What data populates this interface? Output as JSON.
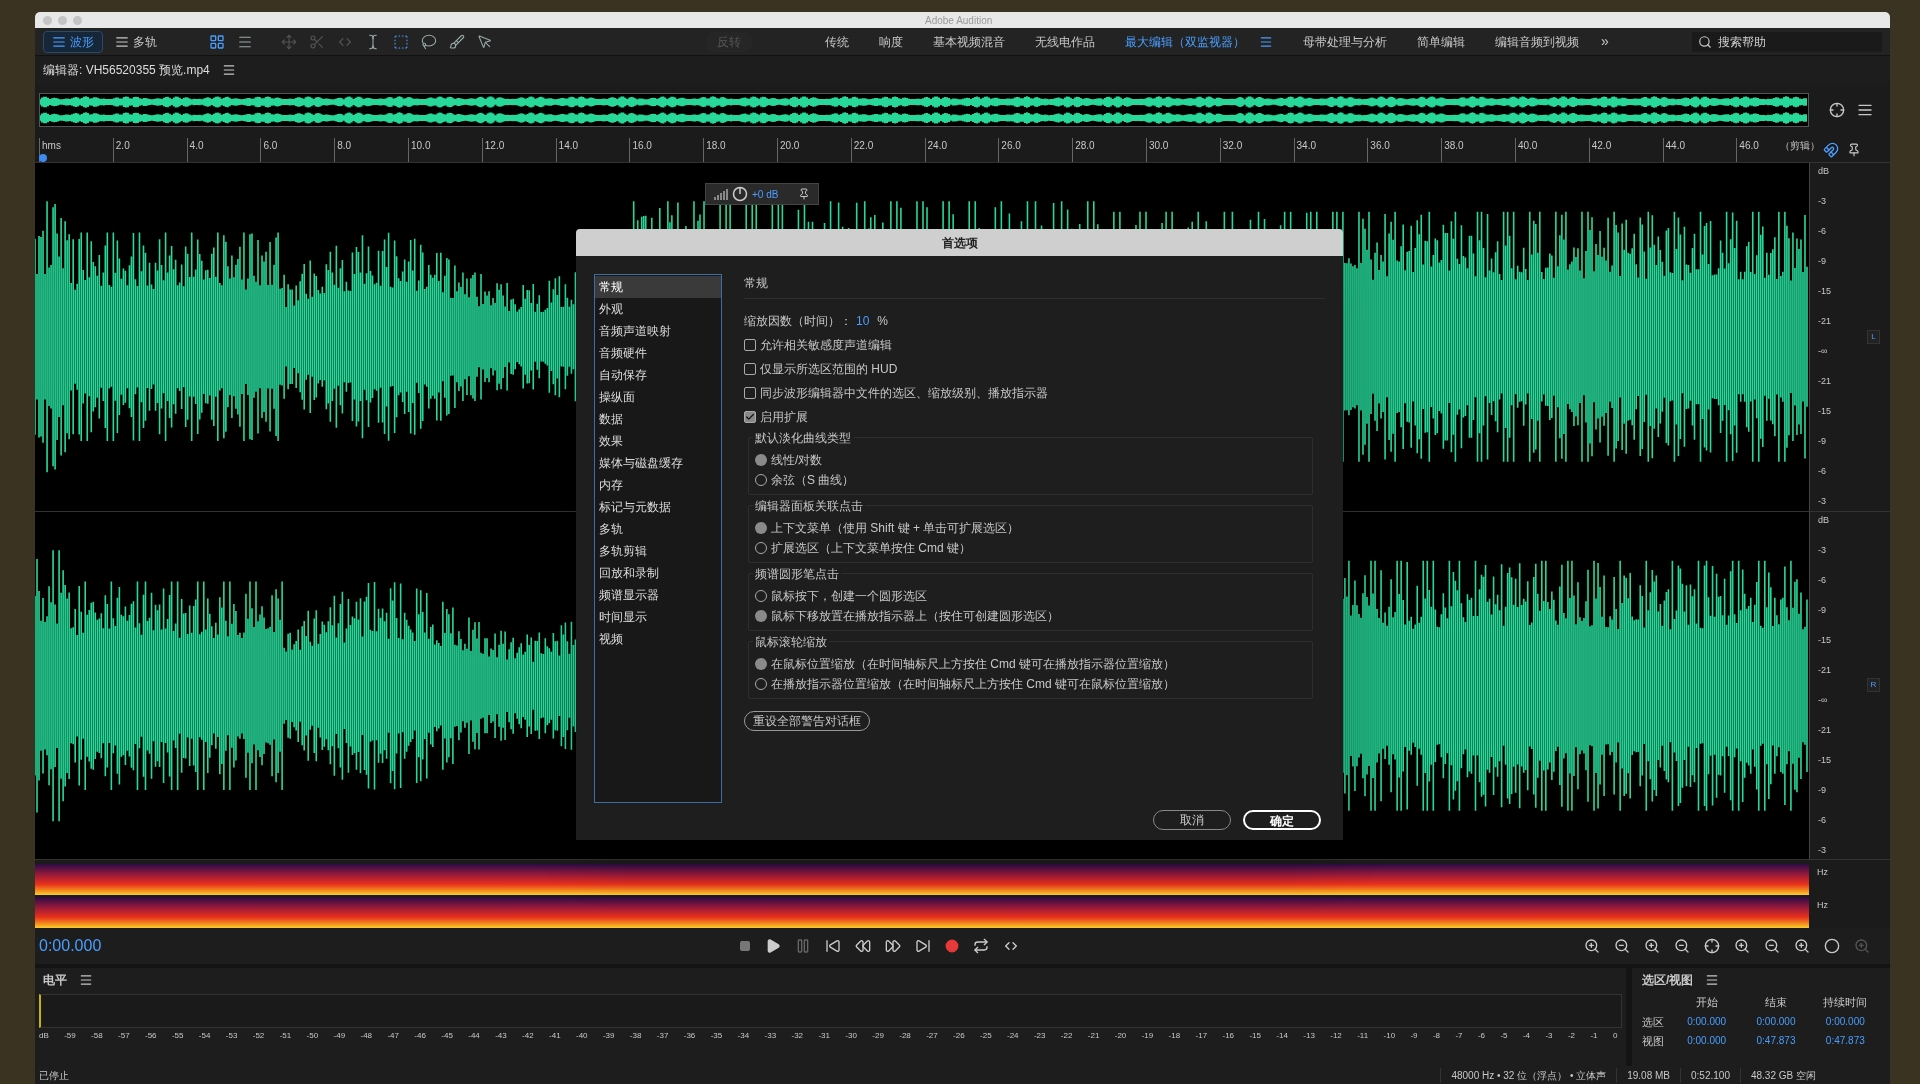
{
  "window": {
    "title": "Adobe Audition"
  },
  "mode_tabs": [
    {
      "label": "波形",
      "selected": true
    },
    {
      "label": "多轨",
      "selected": false
    }
  ],
  "reverse_button": {
    "label": "反转",
    "disabled": true
  },
  "workspaces": [
    {
      "label": "传统",
      "selected": false
    },
    {
      "label": "响度",
      "selected": false
    },
    {
      "label": "基本视频混音",
      "selected": false
    },
    {
      "label": "无线电作品",
      "selected": false
    },
    {
      "label": "最大编辑（双监视器）",
      "selected": true
    },
    {
      "label": "母带处理与分析",
      "selected": false
    },
    {
      "label": "简单编辑",
      "selected": false
    },
    {
      "label": "编辑音频到视频",
      "selected": false
    }
  ],
  "more_workspaces": "»",
  "search": {
    "placeholder": "搜索帮助"
  },
  "editor": {
    "title": "编辑器: VH56520355 预览.mp4"
  },
  "ruler": {
    "labels": [
      "hms",
      "2.0",
      "4.0",
      "6.0",
      "8.0",
      "10.0",
      "12.0",
      "14.0",
      "16.0",
      "18.0",
      "20.0",
      "22.0",
      "24.0",
      "26.0",
      "28.0",
      "30.0",
      "32.0",
      "34.0",
      "36.0",
      "38.0",
      "40.0",
      "42.0",
      "44.0",
      "46.0"
    ],
    "suffix": "（剪辑）"
  },
  "hud": {
    "reading": "+0 dB"
  },
  "db_scales": [
    {
      "channel": "L",
      "labels": [
        "dB",
        "-3",
        "-6",
        "-9",
        "-15",
        "-21",
        "-∞",
        "-21",
        "-15",
        "-9",
        "-6",
        "-3"
      ]
    },
    {
      "channel": "R",
      "labels": [
        "dB",
        "-3",
        "-6",
        "-9",
        "-15",
        "-21",
        "-∞",
        "-21",
        "-15",
        "-9",
        "-6",
        "-3"
      ]
    }
  ],
  "spectrum_labels": [
    "Hz",
    "Hz"
  ],
  "dialog": {
    "title": "首选项",
    "nav": [
      {
        "label": "常规",
        "selected": true
      },
      {
        "label": "外观",
        "selected": false
      },
      {
        "label": "音频声道映射",
        "selected": false
      },
      {
        "label": "音频硬件",
        "selected": false
      },
      {
        "label": "自动保存",
        "selected": false
      },
      {
        "label": "操纵面",
        "selected": false
      },
      {
        "label": "数据",
        "selected": false
      },
      {
        "label": "效果",
        "selected": false
      },
      {
        "label": "媒体与磁盘缓存",
        "selected": false
      },
      {
        "label": "内存",
        "selected": false
      },
      {
        "label": "标记与元数据",
        "selected": false
      },
      {
        "label": "多轨",
        "selected": false
      },
      {
        "label": "多轨剪辑",
        "selected": false
      },
      {
        "label": "回放和录制",
        "selected": false
      },
      {
        "label": "频谱显示器",
        "selected": false
      },
      {
        "label": "时间显示",
        "selected": false
      },
      {
        "label": "视频",
        "selected": false
      }
    ],
    "section_title": "常规",
    "zoom": {
      "label": "缩放因数（时间）：",
      "value": "10",
      "unit": "%"
    },
    "checkboxes": [
      {
        "label": "允许相关敏感度声道编辑",
        "checked": false
      },
      {
        "label": "仅显示所选区范围的 HUD",
        "checked": false
      },
      {
        "label": "同步波形编辑器中文件的选区、缩放级别、播放指示器",
        "checked": false
      },
      {
        "label": "启用扩展",
        "checked": true
      }
    ],
    "groups": [
      {
        "title": "默认淡化曲线类型",
        "options": [
          {
            "label": "线性/对数",
            "selected": true
          },
          {
            "label": "余弦（S 曲线）",
            "selected": false
          }
        ]
      },
      {
        "title": "编辑器面板关联点击",
        "options": [
          {
            "label": "上下文菜单（使用 Shift 键 + 单击可扩展选区）",
            "selected": true
          },
          {
            "label": "扩展选区（上下文菜单按住 Cmd 键）",
            "selected": false
          }
        ]
      },
      {
        "title": "频谱圆形笔点击",
        "options": [
          {
            "label": "鼠标按下，创建一个圆形选区",
            "selected": false
          },
          {
            "label": "鼠标下移放置在播放指示器上（按住可创建圆形选区）",
            "selected": true
          }
        ]
      },
      {
        "title": "鼠标滚轮缩放",
        "options": [
          {
            "label": "在鼠标位置缩放（在时间轴标尺上方按住 Cmd 键可在播放指示器位置缩放）",
            "selected": true
          },
          {
            "label": "在播放指示器位置缩放（在时间轴标尺上方按住 Cmd 键可在鼠标位置缩放）",
            "selected": false
          }
        ]
      }
    ],
    "reset_button": "重设全部警告对话框",
    "buttons": [
      {
        "label": "取消",
        "kind": "cancel"
      },
      {
        "label": "确定",
        "kind": "default"
      }
    ]
  },
  "transport": {
    "time": "0:00.000"
  },
  "levels": {
    "title": "电平",
    "scale": [
      "dB",
      "-59",
      "-58",
      "-57",
      "-56",
      "-55",
      "-54",
      "-53",
      "-52",
      "-51",
      "-50",
      "-49",
      "-48",
      "-47",
      "-46",
      "-45",
      "-44",
      "-43",
      "-42",
      "-41",
      "-40",
      "-39",
      "-38",
      "-37",
      "-36",
      "-35",
      "-34",
      "-33",
      "-32",
      "-31",
      "-30",
      "-29",
      "-28",
      "-27",
      "-26",
      "-25",
      "-24",
      "-23",
      "-22",
      "-21",
      "-20",
      "-19",
      "-18",
      "-17",
      "-16",
      "-15",
      "-14",
      "-13",
      "-12",
      "-11",
      "-10",
      "-9",
      "-8",
      "-7",
      "-6",
      "-5",
      "-4",
      "-3",
      "-2",
      "-1",
      "0"
    ]
  },
  "selection_view": {
    "title": "选区/视图",
    "columns": [
      "开始",
      "结束",
      "持续时间"
    ],
    "rows": [
      {
        "label": "选区",
        "values": [
          "0:00.000",
          "0:00.000",
          "0:00.000"
        ]
      },
      {
        "label": "视图",
        "values": [
          "0:00.000",
          "0:47.873",
          "0:47.873"
        ]
      }
    ]
  },
  "status_bar": {
    "state": "已停止",
    "items": [
      "48000 Hz • 32 位（浮点） • 立体声",
      "19.08 MB",
      "0:52.100",
      "48.32 GB 空闲"
    ]
  }
}
